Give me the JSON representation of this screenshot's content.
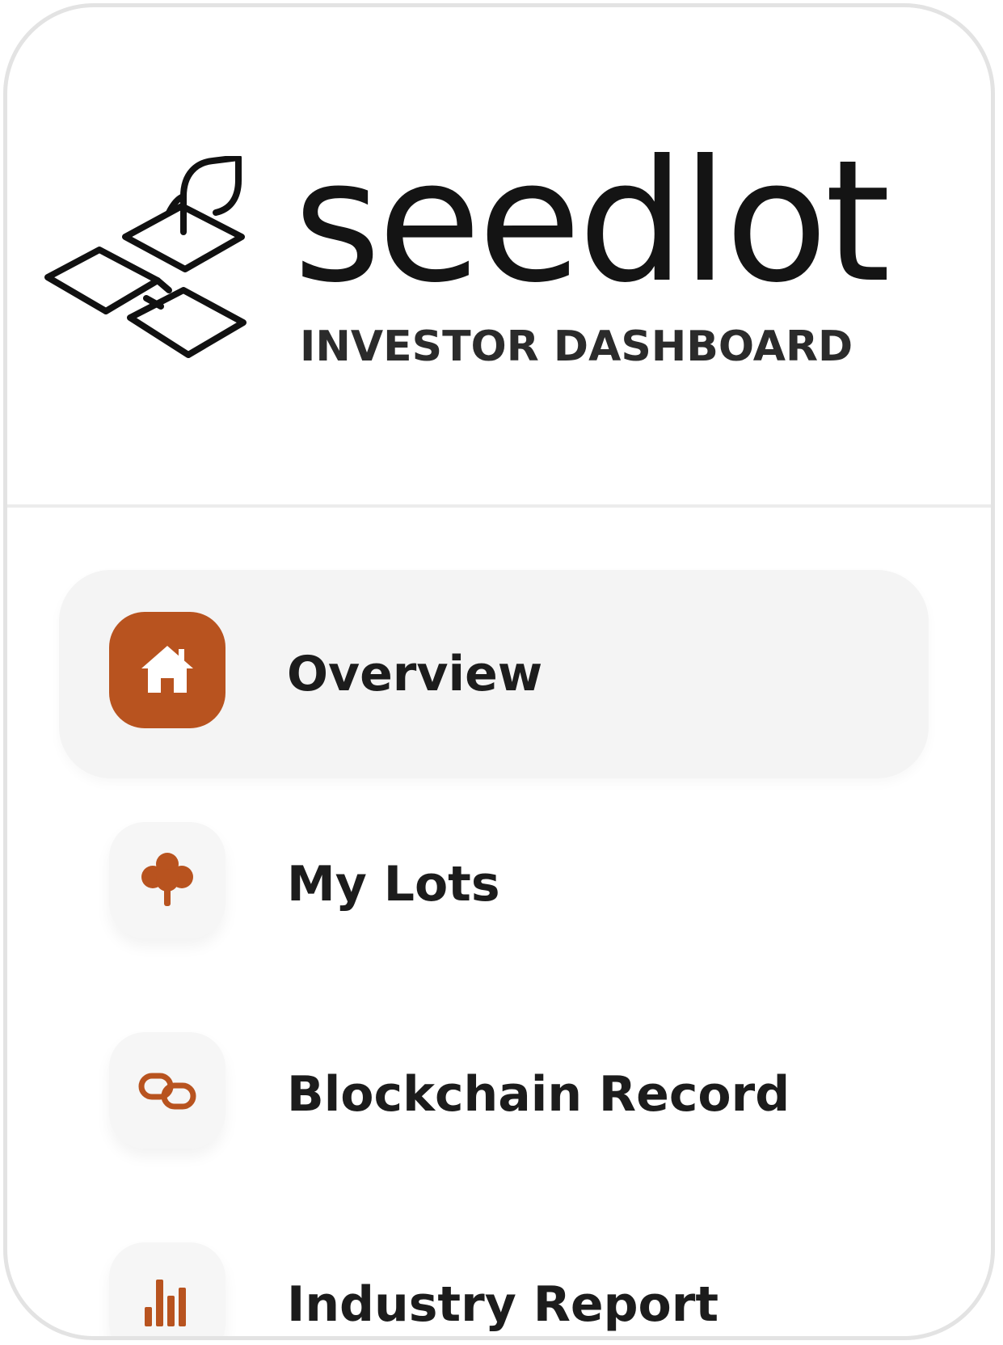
{
  "brand": {
    "name": "seedlot",
    "subtitle": "INVESTOR DASHBOARD",
    "logo_icon": "seedling-plots-icon"
  },
  "colors": {
    "accent": "#b8531f",
    "active_background": "#f4f4f4",
    "text": "#1c1c1c"
  },
  "nav": {
    "items": [
      {
        "label": "Overview",
        "icon": "home-icon",
        "active": true
      },
      {
        "label": "My Lots",
        "icon": "tree-icon",
        "active": false
      },
      {
        "label": "Blockchain Record",
        "icon": "link-icon",
        "active": false
      },
      {
        "label": "Industry Report",
        "icon": "bar-chart-icon",
        "active": false
      }
    ]
  }
}
